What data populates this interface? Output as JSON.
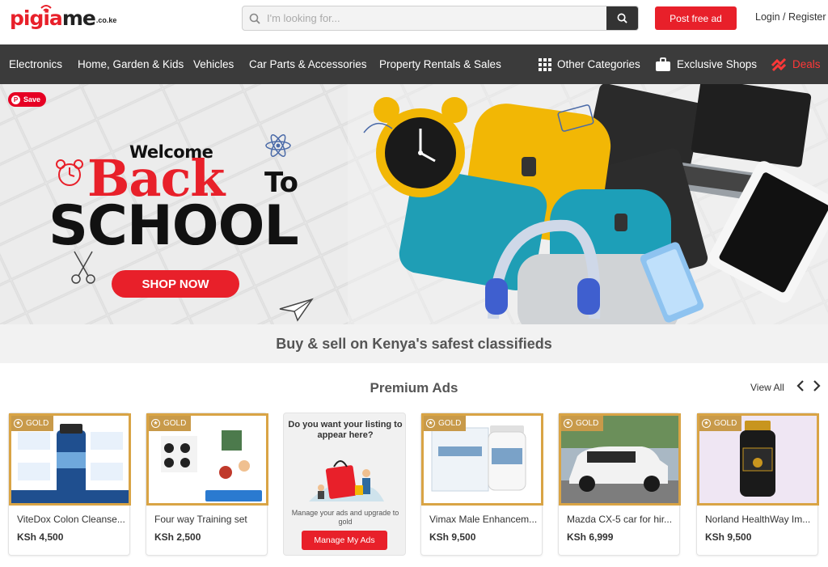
{
  "header": {
    "logo_main": "pigia",
    "logo_me": "me",
    "logo_tld": ".co.ke",
    "search_placeholder": "I'm looking for...",
    "post_ad": "Post free ad",
    "login": "Login / Register"
  },
  "nav": {
    "items": [
      "Electronics",
      "Home, Garden & Kids",
      "Vehicles",
      "Car Parts & Accessories",
      "Property Rentals & Sales"
    ],
    "other": "Other Categories",
    "shops": "Exclusive Shops",
    "deals": "Deals",
    "deals_color": "#ff3838"
  },
  "banner": {
    "save": "Save",
    "welcome": "Welcome",
    "back": "Back",
    "to": "To",
    "school": "SCHOOL",
    "shop_now": "SHOP NOW"
  },
  "tagline": "Buy & sell on Kenya's safest classifieds",
  "premium": {
    "title": "Premium Ads",
    "view_all": "View All",
    "badge": "GOLD",
    "cards": [
      {
        "name": "ViteDox Colon Cleanse...",
        "price": "KSh 4,500"
      },
      {
        "name": "Four way Training set",
        "price": "KSh 2,500"
      },
      {
        "name": "Vimax Male Enhancem...",
        "price": "KSh 9,500"
      },
      {
        "name": "Mazda CX-5 car for hir...",
        "price": "KSh 6,999"
      },
      {
        "name": "Norland HealthWay Im...",
        "price": "KSh 9,500"
      }
    ],
    "promo": {
      "title": "Do you want your listing to appear here?",
      "subtitle": "Manage your ads and upgrade to gold",
      "button": "Manage My Ads"
    }
  },
  "colors": {
    "brand_red": "#e8202a",
    "nav_bg": "#3b3b3b",
    "gold": "#c89a4a"
  }
}
